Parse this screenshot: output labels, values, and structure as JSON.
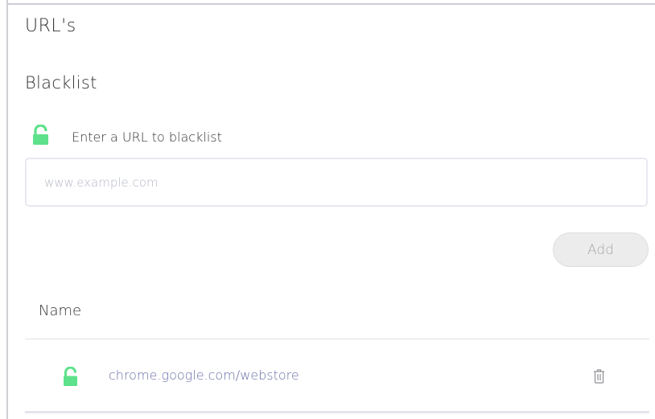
{
  "page": {
    "title": "URL's"
  },
  "blacklist": {
    "section_title": "Blacklist",
    "hint_label": "Enter a URL to blacklist",
    "input_value": "",
    "input_placeholder": "www.example.com",
    "add_label": "Add",
    "add_disabled": true
  },
  "table": {
    "column_name": "Name",
    "rows": [
      {
        "url": "chrome.google.com/webstore",
        "icon": "unlocked-lock-icon",
        "action_icon": "trash-icon"
      }
    ]
  },
  "colors": {
    "accent_green": "#5de18a",
    "link_color": "#6b6fa8",
    "button_bg": "#ececec",
    "button_text": "#a9a9a9"
  }
}
